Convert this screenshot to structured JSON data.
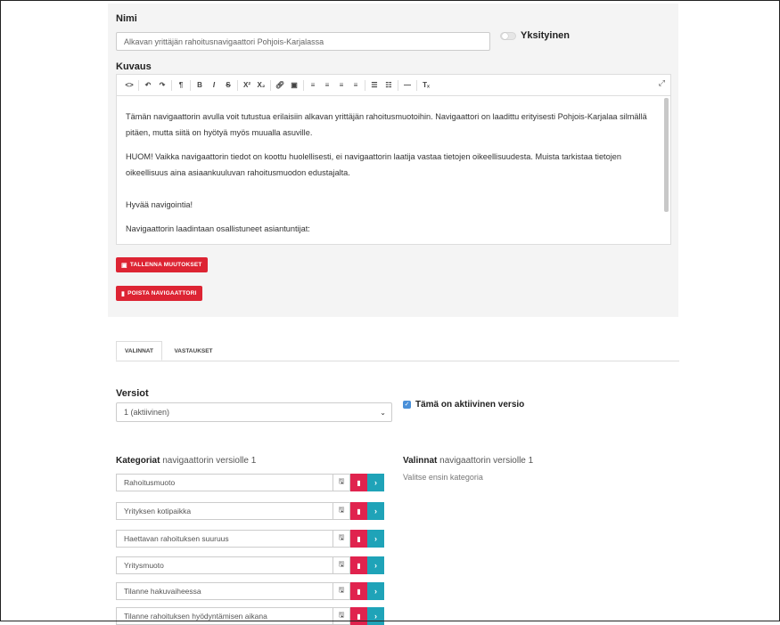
{
  "header": {
    "name_label": "Nimi",
    "name_value": "Alkavan yrittäjän rahoitusnavigaattori Pohjois-Karjalassa",
    "private_label": "Yksityinen",
    "description_label": "Kuvaus"
  },
  "editor": {
    "paragraphs": [
      "Tämän navigaattorin avulla voit tutustua erilaisiin alkavan yrittäjän rahoitusmuotoihin. Navigaattori on laadittu erityisesti Pohjois-Karjalaa silmällä pitäen, mutta siitä on hyötyä myös muualla asuville.",
      "HUOM! Vaikka navigaattorin tiedot on koottu huolellisesti, ei navigaattorin laatija vastaa tietojen oikeellisuudesta. Muista tarkistaa tietojen oikeellisuus aina asiaankuuluvan rahoitusmuodon edustajalta.",
      "Hyvää navigointia!",
      "Navigaattorin laadintaan osallistuneet asiantuntijat:"
    ]
  },
  "buttons": {
    "save": "TALLENNA MUUTOKSET",
    "delete": "POISTA NAVIGAATTORI"
  },
  "tabs": [
    {
      "label": "VALINNAT"
    },
    {
      "label": "VASTAUKSET"
    }
  ],
  "versions": {
    "label": "Versiot",
    "selected": "1 (aktiivinen)",
    "active_label": "Tämä on aktiivinen versio"
  },
  "categories": {
    "title_bold": "Kategoriat",
    "title_rest": " navigaattorin versiolle 1",
    "items": [
      "Rahoitusmuoto",
      "Yrityksen kotipaikka",
      "Haettavan rahoituksen suuruus",
      "Yritysmuoto",
      "Tilanne hakuvaiheessa",
      "Tilanne rahoituksen hyödyntämisen aikana"
    ]
  },
  "choices": {
    "title_bold": "Valinnat",
    "title_rest": " navigaattorin versiolle 1",
    "hint": "Valitse ensin kategoria"
  },
  "colors": {
    "danger": "#dd2433",
    "info": "#1fa3b8",
    "check": "#4a90d9"
  }
}
